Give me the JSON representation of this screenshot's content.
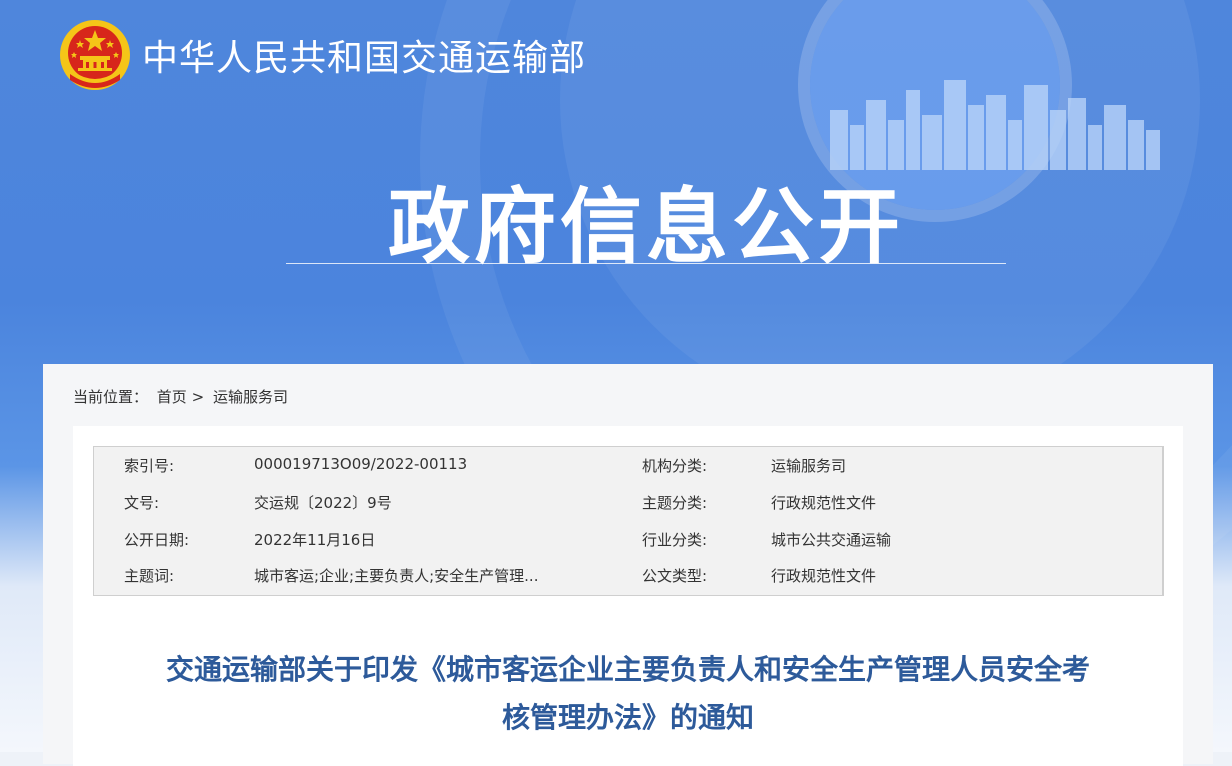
{
  "header": {
    "site_title": "中华人民共和国交通运输部",
    "section_title": "政府信息公开"
  },
  "breadcrumb": {
    "prefix": "当前位置：",
    "home": "首页",
    "separator": ">",
    "current": "运输服务司"
  },
  "meta": [
    {
      "k1": "索引号:",
      "v1": "000019713O09/2022-00113",
      "k2": "机构分类:",
      "v2": "运输服务司"
    },
    {
      "k1": "文号:",
      "v1": "交运规〔2022〕9号",
      "k2": "主题分类:",
      "v2": "行政规范性文件"
    },
    {
      "k1": "公开日期:",
      "v1": "2022年11月16日",
      "k2": "行业分类:",
      "v2": "城市公共交通运输"
    },
    {
      "k1": "主题词:",
      "v1": "城市客运;企业;主要负责人;安全生产管理...",
      "k2": "公文类型:",
      "v2": "行政规范性文件"
    }
  ],
  "document": {
    "title_line1": "交通运输部关于印发《城市客运企业主要负责人和安全生产管理人员安全考",
    "title_line2": "核管理办法》的通知"
  },
  "colors": {
    "header_blue": "#4f86dc",
    "title_blue": "#2d5a9a",
    "emblem_red": "#d7261b",
    "emblem_gold": "#f5c518"
  }
}
